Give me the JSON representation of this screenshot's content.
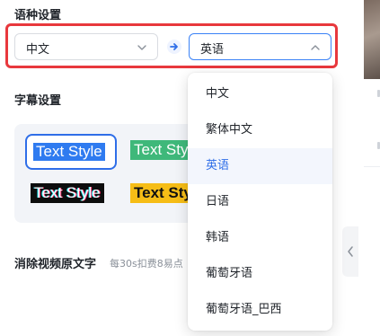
{
  "language_settings": {
    "title": "语种设置",
    "source_language": "中文",
    "target_language": "英语",
    "options": [
      "中文",
      "繁体中文",
      "英语",
      "日语",
      "韩语",
      "葡萄牙语",
      "葡萄牙语_巴西"
    ],
    "selected_option": "英语"
  },
  "subtitle_settings": {
    "title": "字幕设置",
    "styles": [
      {
        "label": "Text Style",
        "variant": "blue-highlight",
        "selected": true
      },
      {
        "label": "Text Style",
        "variant": "green-box"
      },
      {
        "label": "Text Style",
        "variant": "black-glitch"
      },
      {
        "label": "Text Style",
        "variant": "yellow-box"
      }
    ]
  },
  "remove_original_text": {
    "title": "消除视频原文字",
    "cost_note": "每30s扣费8易点"
  },
  "colors": {
    "highlight_border": "#e8383d",
    "accent": "#2f6ee8",
    "panel_bg": "#f2f4f8"
  }
}
